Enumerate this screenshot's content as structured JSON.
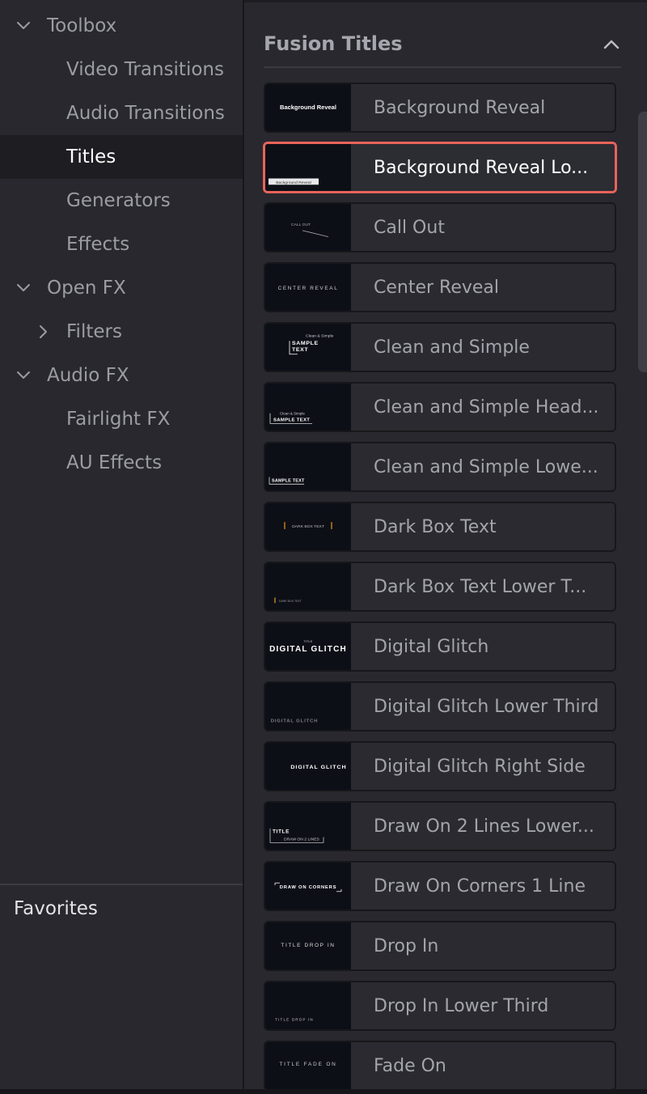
{
  "sidebar": {
    "items": [
      {
        "label": "Toolbox",
        "level": 0,
        "expander": "expanded",
        "selected": false
      },
      {
        "label": "Video Transitions",
        "level": 1,
        "expander": "none",
        "selected": false
      },
      {
        "label": "Audio Transitions",
        "level": 1,
        "expander": "none",
        "selected": false
      },
      {
        "label": "Titles",
        "level": 1,
        "expander": "none",
        "selected": true
      },
      {
        "label": "Generators",
        "level": 1,
        "expander": "none",
        "selected": false
      },
      {
        "label": "Effects",
        "level": 1,
        "expander": "none",
        "selected": false
      },
      {
        "label": "Open FX",
        "level": 0,
        "expander": "expanded",
        "selected": false
      },
      {
        "label": "Filters",
        "level": 1,
        "expander": "collapsed",
        "selected": false
      },
      {
        "label": "Audio FX",
        "level": 0,
        "expander": "expanded",
        "selected": false
      },
      {
        "label": "Fairlight FX",
        "level": 1,
        "expander": "none",
        "selected": false
      },
      {
        "label": "AU Effects",
        "level": 1,
        "expander": "none",
        "selected": false
      }
    ],
    "favorites_label": "Favorites"
  },
  "main": {
    "section_title": "Fusion Titles",
    "collapse_icon": "chevron-up-icon",
    "titles": [
      {
        "label": "Background Reveal",
        "thumb_text": "Background Reveal",
        "selected": false
      },
      {
        "label": "Background Reveal Lo...",
        "thumb_text": "Background Reveal",
        "selected": true
      },
      {
        "label": "Call Out",
        "thumb_text": "CALL OUT",
        "selected": false
      },
      {
        "label": "Center Reveal",
        "thumb_text": "CENTER REVEAL",
        "selected": false
      },
      {
        "label": "Clean and Simple",
        "thumb_text": "Clean & Simple|SAMPLE|TEXT",
        "selected": false
      },
      {
        "label": "Clean and Simple Head...",
        "thumb_text": "Clean & Simple|SAMPLE TEXT",
        "selected": false
      },
      {
        "label": "Clean and Simple Lowe...",
        "thumb_text": "SAMPLE TEXT",
        "selected": false
      },
      {
        "label": "Dark Box Text",
        "thumb_text": "DARK BOX TEXT",
        "selected": false
      },
      {
        "label": "Dark Box Text Lower T...",
        "thumb_text": "DARK BOX TEXT",
        "selected": false
      },
      {
        "label": "Digital Glitch",
        "thumb_text": "TITLE|DIGITAL GLITCH",
        "selected": false
      },
      {
        "label": "Digital Glitch Lower Third",
        "thumb_text": "DIGITAL GLITCH",
        "selected": false
      },
      {
        "label": "Digital Glitch Right Side",
        "thumb_text": "DIGITAL GLITCH",
        "selected": false
      },
      {
        "label": "Draw On 2 Lines Lower...",
        "thumb_text": "TITLE|DRAW ON 2 LINES",
        "selected": false
      },
      {
        "label": "Draw On Corners 1 Line",
        "thumb_text": "DRAW ON CORNERS",
        "selected": false
      },
      {
        "label": "Drop In",
        "thumb_text": "TITLE DROP IN",
        "selected": false
      },
      {
        "label": "Drop In Lower Third",
        "thumb_text": "TITLE DROP IN",
        "selected": false
      },
      {
        "label": "Fade On",
        "thumb_text": "TITLE FADE ON",
        "selected": false
      }
    ]
  },
  "colors": {
    "panel_bg": "#28282e",
    "card_bg": "#2a2a30",
    "thumb_bg": "#0d0f17",
    "selected_border": "#e8635a",
    "text_dim": "#9c9ca4",
    "text_bright": "#ffffff",
    "accent_orange": "#c98a1a"
  }
}
